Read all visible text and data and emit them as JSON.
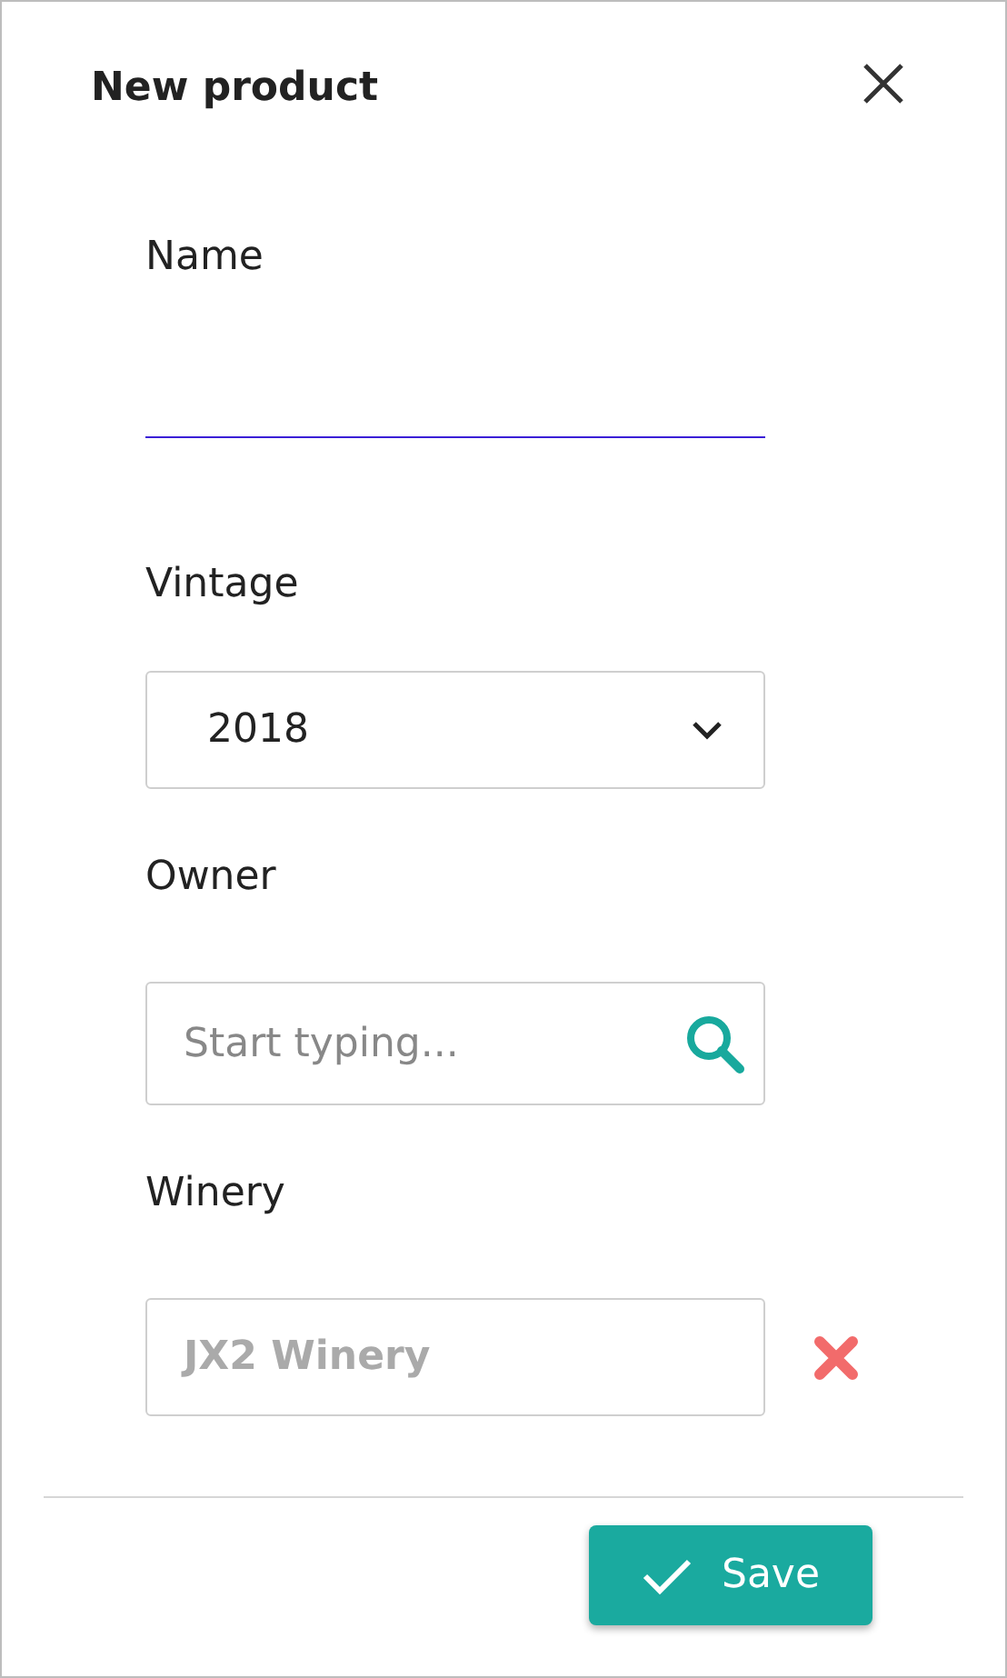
{
  "title": "New product",
  "fields": [
    {
      "kind": "text",
      "label": "Name"
    },
    {
      "kind": "select",
      "label": "Vintage",
      "value": "2018"
    },
    {
      "kind": "search",
      "label": "Owner",
      "placeholder": "Start typing..."
    },
    {
      "kind": "clearable",
      "label": "Winery",
      "value": "JX2 Winery",
      "disabled": true
    }
  ],
  "save_button": "Save"
}
